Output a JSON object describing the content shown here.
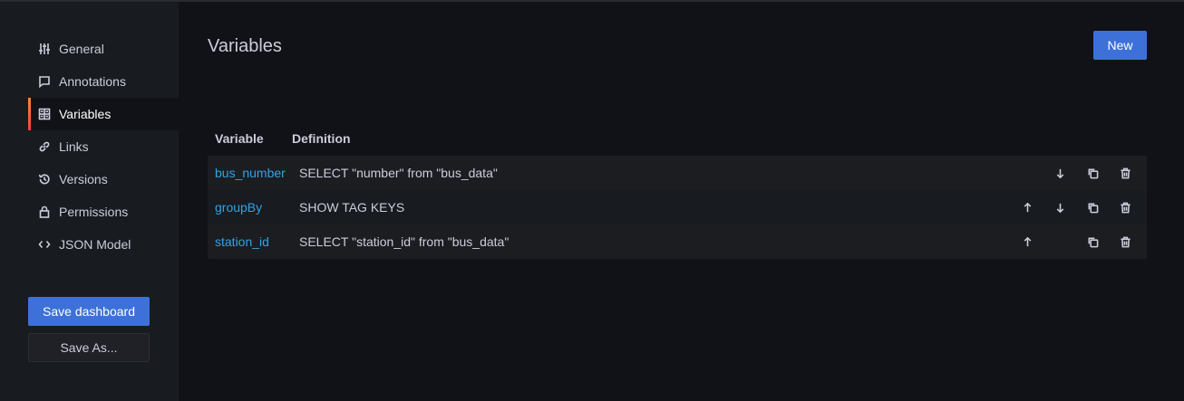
{
  "sidebar": {
    "items": [
      {
        "label": "General",
        "icon": "sliders-icon",
        "active": false
      },
      {
        "label": "Annotations",
        "icon": "comment-icon",
        "active": false
      },
      {
        "label": "Variables",
        "icon": "calculator-icon",
        "active": true
      },
      {
        "label": "Links",
        "icon": "link-icon",
        "active": false
      },
      {
        "label": "Versions",
        "icon": "history-icon",
        "active": false
      },
      {
        "label": "Permissions",
        "icon": "lock-icon",
        "active": false
      },
      {
        "label": "JSON Model",
        "icon": "code-icon",
        "active": false
      }
    ],
    "save_label": "Save dashboard",
    "save_as_label": "Save As..."
  },
  "main": {
    "title": "Variables",
    "new_label": "New",
    "table": {
      "headers": {
        "variable": "Variable",
        "definition": "Definition"
      },
      "rows": [
        {
          "variable": "bus_number",
          "definition": "SELECT \"number\" from \"bus_data\"",
          "up": false,
          "down": true
        },
        {
          "variable": "groupBy",
          "definition": "SHOW TAG KEYS",
          "up": true,
          "down": true
        },
        {
          "variable": "station_id",
          "definition": "SELECT \"station_id\" from \"bus_data\"",
          "up": true,
          "down": false
        }
      ]
    }
  },
  "colors": {
    "background": "#111217",
    "sidebar": "#181b1f",
    "primary": "#3d71d9",
    "link": "#33a2e5",
    "active_indicator": "#ff8833"
  }
}
